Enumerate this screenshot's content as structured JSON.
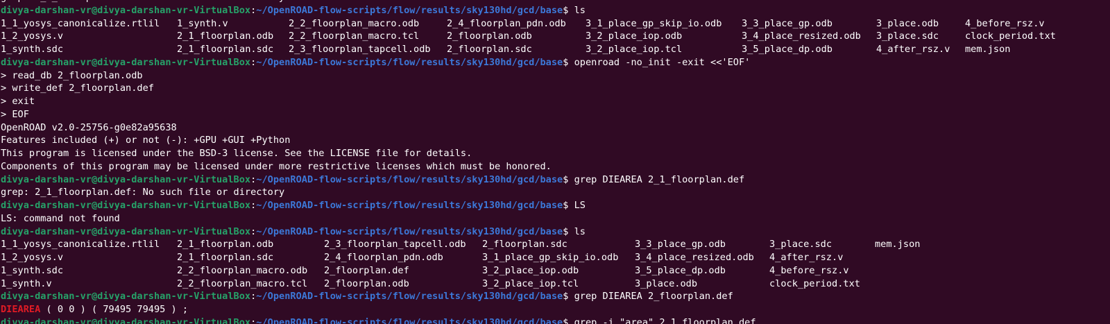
{
  "terminal": {
    "colors": {
      "background": "#300a24",
      "user_host": "#26a269",
      "path": "#3c78d8",
      "highlight": "#e01b24"
    },
    "lines": [
      {
        "type": "text",
        "text": "grep: 2_1_floorplan.def: No such file or directory"
      },
      {
        "type": "prompt",
        "user": "divya-darshan-vr@divya-darshan-vr-VirtualBox",
        "path": "~/OpenROAD-flow-scripts/flow/results/sky130hd/gcd/base",
        "cmd": "ls"
      },
      {
        "type": "cols",
        "widths": [
          254,
          161,
          228,
          200,
          225,
          194,
          128,
          140
        ],
        "cells": [
          "1_1_yosys_canonicalize.rtlil",
          "1_synth.v",
          "2_2_floorplan_macro.odb",
          "2_4_floorplan_pdn.odb",
          "3_1_place_gp_skip_io.odb",
          "3_3_place_gp.odb",
          "3_place.odb",
          "4_before_rsz.v"
        ]
      },
      {
        "type": "cols",
        "widths": [
          254,
          161,
          228,
          200,
          225,
          194,
          128,
          140
        ],
        "cells": [
          "1_2_yosys.v",
          "2_1_floorplan.odb",
          "2_2_floorplan_macro.tcl",
          "2_floorplan.odb",
          "3_2_place_iop.odb",
          "3_4_place_resized.odb",
          "3_place.sdc",
          "clock_period.txt"
        ]
      },
      {
        "type": "cols",
        "widths": [
          254,
          161,
          228,
          200,
          225,
          194,
          128,
          140
        ],
        "cells": [
          "1_synth.sdc",
          "2_1_floorplan.sdc",
          "2_3_floorplan_tapcell.odb",
          "2_floorplan.sdc",
          "3_2_place_iop.tcl",
          "3_5_place_dp.odb",
          "4_after_rsz.v",
          "mem.json"
        ]
      },
      {
        "type": "prompt",
        "user": "divya-darshan-vr@divya-darshan-vr-VirtualBox",
        "path": "~/OpenROAD-flow-scripts/flow/results/sky130hd/gcd/base",
        "cmd": "openroad -no_init -exit <<'EOF'"
      },
      {
        "type": "text",
        "text": "> read_db 2_floorplan.odb"
      },
      {
        "type": "text",
        "text": "> write_def 2_floorplan.def"
      },
      {
        "type": "text",
        "text": "> exit"
      },
      {
        "type": "text",
        "text": "> EOF"
      },
      {
        "type": "text",
        "text": "OpenROAD v2.0-25756-g0e82a95638"
      },
      {
        "type": "text",
        "text": "Features included (+) or not (-): +GPU +GUI +Python"
      },
      {
        "type": "text",
        "text": "This program is licensed under the BSD-3 license. See the LICENSE file for details."
      },
      {
        "type": "text",
        "text": "Components of this program may be licensed under more restrictive licenses which must be honored."
      },
      {
        "type": "prompt",
        "user": "divya-darshan-vr@divya-darshan-vr-VirtualBox",
        "path": "~/OpenROAD-flow-scripts/flow/results/sky130hd/gcd/base",
        "cmd": "grep DIEAREA 2_1_floorplan.def"
      },
      {
        "type": "text",
        "text": "grep: 2_1_floorplan.def: No such file or directory"
      },
      {
        "type": "prompt",
        "user": "divya-darshan-vr@divya-darshan-vr-VirtualBox",
        "path": "~/OpenROAD-flow-scripts/flow/results/sky130hd/gcd/base",
        "cmd": "LS"
      },
      {
        "type": "text",
        "text": "LS: command not found"
      },
      {
        "type": "prompt",
        "user": "divya-darshan-vr@divya-darshan-vr-VirtualBox",
        "path": "~/OpenROAD-flow-scripts/flow/results/sky130hd/gcd/base",
        "cmd": "ls"
      },
      {
        "type": "cols",
        "widths": [
          254,
          212,
          228,
          220,
          194,
          152,
          130
        ],
        "cells": [
          "1_1_yosys_canonicalize.rtlil",
          "2_1_floorplan.odb",
          "2_3_floorplan_tapcell.odb",
          "2_floorplan.sdc",
          "3_3_place_gp.odb",
          "3_place.sdc",
          "mem.json"
        ]
      },
      {
        "type": "cols",
        "widths": [
          254,
          212,
          228,
          220,
          194,
          152,
          130
        ],
        "cells": [
          "1_2_yosys.v",
          "2_1_floorplan.sdc",
          "2_4_floorplan_pdn.odb",
          "3_1_place_gp_skip_io.odb",
          "3_4_place_resized.odb",
          "4_after_rsz.v",
          ""
        ]
      },
      {
        "type": "cols",
        "widths": [
          254,
          212,
          228,
          220,
          194,
          152,
          130
        ],
        "cells": [
          "1_synth.sdc",
          "2_2_floorplan_macro.odb",
          "2_floorplan.def",
          "3_2_place_iop.odb",
          "3_5_place_dp.odb",
          "4_before_rsz.v",
          ""
        ]
      },
      {
        "type": "cols",
        "widths": [
          254,
          212,
          228,
          220,
          194,
          152,
          130
        ],
        "cells": [
          "1_synth.v",
          "2_2_floorplan_macro.tcl",
          "2_floorplan.odb",
          "3_2_place_iop.tcl",
          "3_place.odb",
          "clock_period.txt",
          ""
        ]
      },
      {
        "type": "prompt",
        "user": "divya-darshan-vr@divya-darshan-vr-VirtualBox",
        "path": "~/OpenROAD-flow-scripts/flow/results/sky130hd/gcd/base",
        "cmd": "grep DIEAREA 2_floorplan.def"
      },
      {
        "type": "highlight",
        "keyword": "DIEAREA",
        "rest": " ( 0 0 ) ( 79495 79495 ) ;"
      },
      {
        "type": "prompt",
        "user": "divya-darshan-vr@divya-darshan-vr-VirtualBox",
        "path": "~/OpenROAD-flow-scripts/flow/results/sky130hd/gcd/base",
        "cmd": "grep -i \"area\" 2_1_floorplan.def"
      }
    ]
  }
}
